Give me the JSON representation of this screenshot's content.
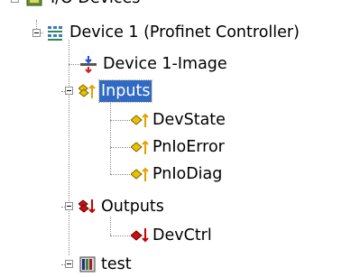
{
  "tree": {
    "top_partial_label": "I/O Devices",
    "items": [
      {
        "label": "Device 1 (Profinet Controller)",
        "icon": "network-device-icon",
        "expanded": true
      },
      {
        "label": "Device 1-Image",
        "icon": "process-image-icon"
      },
      {
        "label": "Inputs",
        "icon": "input-variables-icon",
        "expanded": true,
        "selected": true
      },
      {
        "label": "DevState",
        "icon": "input-variable-icon"
      },
      {
        "label": "PnIoError",
        "icon": "input-variable-icon"
      },
      {
        "label": "PnIoDiag",
        "icon": "input-variable-icon"
      },
      {
        "label": "Outputs",
        "icon": "output-variables-icon",
        "expanded": true
      },
      {
        "label": "DevCtrl",
        "icon": "output-variable-icon"
      },
      {
        "label": "test",
        "icon": "module-box-icon",
        "expanded": true
      }
    ],
    "colors": {
      "selection": "#316ac5",
      "input_arrow": "#e8a000",
      "output_arrow": "#cc0000",
      "connector": "#8c8c8c"
    }
  }
}
